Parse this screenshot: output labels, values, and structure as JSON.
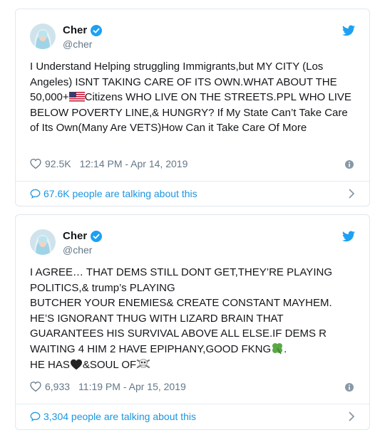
{
  "tweets": [
    {
      "name": "Cher",
      "handle": "@cher",
      "text_part1": "I Understand Helping struggling Immigrants,but MY CITY (Los Angeles) ISNT TAKING CARE OF ITS OWN.WHAT ABOUT THE 50,000+",
      "text_part2": "Citizens WHO LIVE ON THE STREETS.PPL WHO LIVE BELOW POVERTY LINE,& HUNGRY? If My State Can’t Take Care of Its Own(Many Are VETS)How Can it Take Care Of More",
      "likes": "92.5K",
      "timestamp": "12:14 PM - Apr 14, 2019",
      "talking": "67.6K people are talking about this",
      "emoji_1": "us-flag-emoji"
    },
    {
      "name": "Cher",
      "handle": "@cher",
      "text_part1": "I AGREE… THAT DEMS STILL DONT GET,THEY’RE PLAYING POLITICS,& trump’s PLAYING\nBUTCHER YOUR ENEMIES& CREATE CONSTANT MAYHEM. HE’S IGNORANT THUG WITH LIZARD BRAIN THAT GUARANTEES HIS SURVIVAL ABOVE ALL ELSE.IF DEMS R WAITING 4 HIM 2 HAVE EPIPHANY,GOOD FKNG",
      "text_part2": ".\nHE HAS",
      "text_part3": "&SOUL OF",
      "likes": "6,933",
      "timestamp": "11:19 PM - Apr 15, 2019",
      "talking": "3,304 people are talking about this",
      "emoji_1": "four-leaf-clover-emoji",
      "emoji_2": "black-heart-emoji",
      "emoji_3": "skull-crossbones-emoji"
    }
  ],
  "colors": {
    "twitter_blue": "#1da1f2",
    "link_blue": "#1b95e0",
    "meta_gray": "#657786",
    "border": "#e1e8ed"
  }
}
